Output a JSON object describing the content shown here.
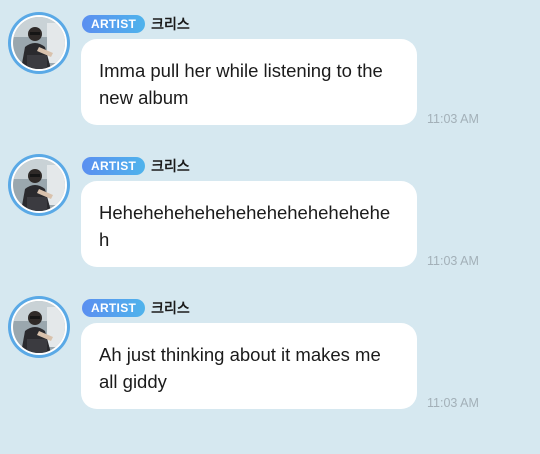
{
  "messages": [
    {
      "badge": "ARTIST",
      "sender": "크리스",
      "text": "Imma pull her while listening to the new album",
      "time": "11:03 AM"
    },
    {
      "badge": "ARTIST",
      "sender": "크리스",
      "text": "Hehehehehehehehehehehehehehe h",
      "time": "11:03 AM"
    },
    {
      "badge": "ARTIST",
      "sender": "크리스",
      "text": "Ah just thinking about it makes me all giddy",
      "time": "11:03 AM"
    }
  ],
  "colors": {
    "background": "#d6e8f0",
    "bubble": "#ffffff",
    "badge_start": "#5b8ff0",
    "badge_end": "#4fb3ec",
    "avatar_ring": "#5aa9e6",
    "timestamp": "#a3b0b8"
  },
  "icons": {
    "avatar": "artist-profile-photo"
  }
}
